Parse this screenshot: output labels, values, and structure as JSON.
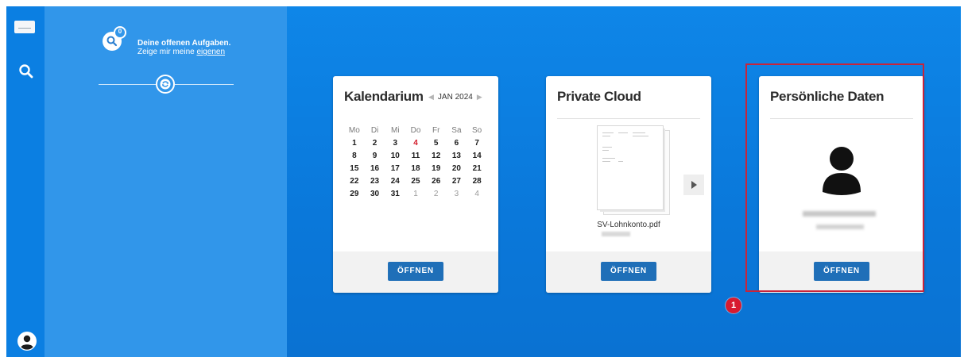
{
  "colors": {
    "accent": "#0a78da",
    "button": "#1f6fb8",
    "today": "#d21b2a",
    "highlight": "#c8243a"
  },
  "sidebar": {
    "search_icon": "search-icon",
    "user_icon": "user-icon"
  },
  "tasks": {
    "count": "0",
    "line1": "Deine offenen Aufgaben.",
    "line2_prefix": "Zeige mir meine ",
    "line2_link": "eigenen",
    "sync_icon": "refresh-icon"
  },
  "calendar": {
    "title": "Kalendarium",
    "month": "JAN 2024",
    "weekdays": [
      "Mo",
      "Di",
      "Mi",
      "Do",
      "Fr",
      "Sa",
      "So"
    ],
    "days": [
      {
        "d": "1"
      },
      {
        "d": "2"
      },
      {
        "d": "3"
      },
      {
        "d": "4",
        "today": true
      },
      {
        "d": "5"
      },
      {
        "d": "6"
      },
      {
        "d": "7"
      },
      {
        "d": "8"
      },
      {
        "d": "9"
      },
      {
        "d": "10"
      },
      {
        "d": "11"
      },
      {
        "d": "12"
      },
      {
        "d": "13"
      },
      {
        "d": "14"
      },
      {
        "d": "15"
      },
      {
        "d": "16"
      },
      {
        "d": "17"
      },
      {
        "d": "18"
      },
      {
        "d": "19"
      },
      {
        "d": "20"
      },
      {
        "d": "21"
      },
      {
        "d": "22"
      },
      {
        "d": "23"
      },
      {
        "d": "24"
      },
      {
        "d": "25"
      },
      {
        "d": "26"
      },
      {
        "d": "27"
      },
      {
        "d": "28"
      },
      {
        "d": "29"
      },
      {
        "d": "30"
      },
      {
        "d": "31"
      },
      {
        "d": "1",
        "other": true
      },
      {
        "d": "2",
        "other": true
      },
      {
        "d": "3",
        "other": true
      },
      {
        "d": "4",
        "other": true
      }
    ],
    "open_label": "ÖFFNEN"
  },
  "cloud": {
    "title": "Private Cloud",
    "file_name": "SV-Lohnkonto.pdf",
    "open_label": "ÖFFNEN"
  },
  "personal": {
    "title": "Persönliche Daten",
    "open_label": "ÖFFNEN"
  },
  "annotation": {
    "marker": "1"
  }
}
